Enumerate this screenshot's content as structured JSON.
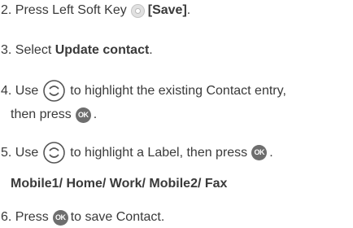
{
  "steps": [
    {
      "number": "2.",
      "text_before": "Press Left Soft Key",
      "icon": "left-soft-key-icon",
      "bold_text": "[Save]",
      "text_after": "."
    },
    {
      "number": "3.",
      "text_before": "Select",
      "bold_text": "Update contact",
      "text_after": "."
    },
    {
      "number": "4.",
      "text_before": "Use",
      "icon": "navigation-key-icon",
      "text_after": "to highlight the existing Contact entry,",
      "continuation": "then press",
      "continuation_icon": "ok-key-icon",
      "continuation_end": "."
    },
    {
      "number": "5.",
      "text_before": "Use",
      "icon": "navigation-key-icon",
      "text_after": "to highlight a Label, then press",
      "end_icon": "ok-key-icon",
      "end": "."
    },
    {
      "number": "6.",
      "text_before": "Press",
      "icon": "ok-key-icon",
      "text_after": "to save Contact."
    }
  ],
  "label_options": "Mobile1/ Home/ Work/ Mobile2/ Fax",
  "ok_icon_text": "OK",
  "colors": {
    "text": "#3a3a3a",
    "ok_key": "#6e6e6e",
    "soft_key": "#e1e1e1"
  }
}
